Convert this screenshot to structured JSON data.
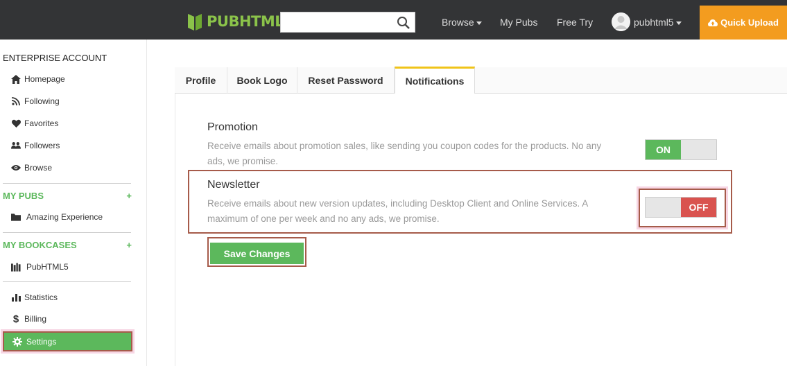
{
  "header": {
    "logo_text": "PUBHTML5",
    "search": {
      "value": "",
      "placeholder": ""
    },
    "nav": {
      "browse": "Browse",
      "my_pubs": "My Pubs",
      "free_try": "Free Try"
    },
    "username": "pubhtml5",
    "quick_upload": "Quick Upload"
  },
  "sidebar": {
    "account_heading": "ENTERPRISE ACCOUNT",
    "items": [
      {
        "label": "Homepage",
        "icon": "home-icon"
      },
      {
        "label": "Following",
        "icon": "rss-icon"
      },
      {
        "label": "Favorites",
        "icon": "heart-icon"
      },
      {
        "label": "Followers",
        "icon": "users-icon"
      },
      {
        "label": "Browse",
        "icon": "eye-icon"
      }
    ],
    "my_pubs": {
      "heading": "MY PUBS",
      "add": "+",
      "items": [
        {
          "label": "Amazing Experience",
          "icon": "folder-icon"
        }
      ]
    },
    "my_bookcases": {
      "heading": "MY BOOKCASES",
      "add": "+",
      "items": [
        {
          "label": "PubHTML5",
          "icon": "books-icon"
        }
      ]
    },
    "bottom_items": [
      {
        "label": "Statistics",
        "icon": "bar-chart-icon"
      },
      {
        "label": "Billing",
        "icon": "dollar-icon"
      },
      {
        "label": "Settings",
        "icon": "gear-icon",
        "active": true
      }
    ]
  },
  "tabs": [
    {
      "label": "Profile"
    },
    {
      "label": "Book Logo"
    },
    {
      "label": "Reset Password"
    },
    {
      "label": "Notifications",
      "active": true
    }
  ],
  "notifications": {
    "promotion": {
      "title": "Promotion",
      "desc_line1": "Receive emails about promotion sales, like sending you coupon codes for the products. No any",
      "desc_line2": "ads, we promise.",
      "state": "ON"
    },
    "newsletter": {
      "title": "Newsletter",
      "desc_line1": "Receive emails about new version updates, including Desktop Client and Online Services. A",
      "desc_line2": "maximum of one per week and no any ads, we promise.",
      "state": "OFF"
    },
    "save_button": "Save Changes"
  },
  "colors": {
    "topbar": "#333436",
    "brand_green": "#5cb85c",
    "accent_orange": "#f39c1f",
    "off_red": "#d9534f",
    "highlight_border": "#a65b4a"
  }
}
